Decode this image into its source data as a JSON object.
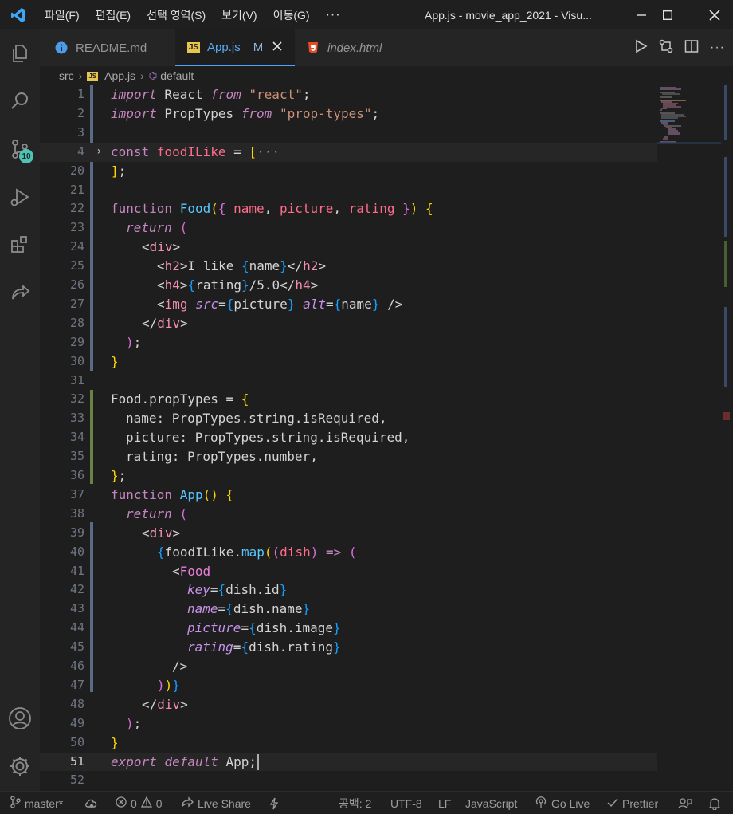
{
  "menu": [
    "파일(F)",
    "편집(E)",
    "선택 영역(S)",
    "보기(V)",
    "이동(G)"
  ],
  "window_title": "App.js - movie_app_2021 - Visu...",
  "activity": {
    "scm_badge": "10"
  },
  "tabs": [
    {
      "label": "README.md",
      "icon": "info-icon"
    },
    {
      "label": "App.js",
      "icon": "js-file-icon",
      "modified": "M",
      "active": true
    },
    {
      "label": "index.html",
      "icon": "html5-icon"
    }
  ],
  "breadcrumb": {
    "folder": "src",
    "file": "App.js",
    "symbol": "default",
    "file_icon_text": "JS"
  },
  "code_lines": [
    {
      "n": "1"
    },
    {
      "n": "2"
    },
    {
      "n": "3"
    },
    {
      "n": "4"
    },
    {
      "n": "20"
    },
    {
      "n": "21"
    },
    {
      "n": "22"
    },
    {
      "n": "23"
    },
    {
      "n": "24"
    },
    {
      "n": "25"
    },
    {
      "n": "26"
    },
    {
      "n": "27"
    },
    {
      "n": "28"
    },
    {
      "n": "29"
    },
    {
      "n": "30"
    },
    {
      "n": "31"
    },
    {
      "n": "32"
    },
    {
      "n": "33"
    },
    {
      "n": "34"
    },
    {
      "n": "35"
    },
    {
      "n": "36"
    },
    {
      "n": "37"
    },
    {
      "n": "38"
    },
    {
      "n": "39"
    },
    {
      "n": "40"
    },
    {
      "n": "41"
    },
    {
      "n": "42"
    },
    {
      "n": "43"
    },
    {
      "n": "44"
    },
    {
      "n": "45"
    },
    {
      "n": "46"
    },
    {
      "n": "47"
    },
    {
      "n": "48"
    },
    {
      "n": "49"
    },
    {
      "n": "50"
    },
    {
      "n": "51"
    },
    {
      "n": "52"
    }
  ],
  "code": {
    "l1": [
      "import",
      " React ",
      "from",
      " ",
      "\"react\"",
      ";"
    ],
    "l2": [
      "import",
      " PropTypes ",
      "from",
      " ",
      "\"prop-types\"",
      ";"
    ],
    "l4": [
      "const",
      " ",
      "foodILike",
      " = ",
      "[",
      "···"
    ],
    "l20": [
      "]",
      ";"
    ],
    "l22": [
      "function",
      " ",
      "Food",
      "(",
      "{",
      " ",
      "name",
      ", ",
      "picture",
      ", ",
      "rating",
      " ",
      "}",
      ")",
      " ",
      "{"
    ],
    "l23": [
      "return",
      " ",
      "("
    ],
    "l24": [
      "<",
      "div",
      ">"
    ],
    "l25": [
      "<",
      "h2",
      ">",
      "I like ",
      "{",
      "name",
      "}",
      "</",
      "h2",
      ">"
    ],
    "l26": [
      "<",
      "h4",
      ">",
      "{",
      "rating",
      "}",
      "/5.0",
      "</",
      "h4",
      ">"
    ],
    "l27": [
      "<",
      "img",
      " ",
      "src",
      "=",
      "{",
      "picture",
      "}",
      " ",
      "alt",
      "=",
      "{",
      "name",
      "}",
      " />"
    ],
    "l28": [
      "</",
      "div",
      ">"
    ],
    "l29": [
      ")",
      ";"
    ],
    "l30": [
      "}"
    ],
    "l32": [
      "Food.propTypes",
      " = ",
      "{"
    ],
    "l33": [
      "name: PropTypes.string.isRequired,"
    ],
    "l34": [
      "picture: PropTypes.string.isRequired,"
    ],
    "l35": [
      "rating: PropTypes.number,"
    ],
    "l36": [
      "}",
      ";"
    ],
    "l37": [
      "function",
      " ",
      "App",
      "(",
      ")",
      " ",
      "{"
    ],
    "l38": [
      "return",
      " ",
      "("
    ],
    "l39": [
      "<",
      "div",
      ">"
    ],
    "l40": [
      "{",
      "foodILike",
      ".",
      "map",
      "(",
      "(",
      "dish",
      ")",
      " => ",
      "("
    ],
    "l41": [
      "<",
      "Food"
    ],
    "l42": [
      "key",
      "=",
      "{",
      "dish.id",
      "}"
    ],
    "l43": [
      "name",
      "=",
      "{",
      "dish.name",
      "}"
    ],
    "l44": [
      "picture",
      "=",
      "{",
      "dish.image",
      "}"
    ],
    "l45": [
      "rating",
      "=",
      "{",
      "dish.rating",
      "}"
    ],
    "l46": [
      "/>"
    ],
    "l47": [
      ")",
      ")",
      "}"
    ],
    "l48": [
      "</",
      "div",
      ">"
    ],
    "l49": [
      ")",
      ";"
    ],
    "l50": [
      "}"
    ],
    "l51": [
      "export",
      " ",
      "default",
      " App;"
    ]
  },
  "status": {
    "branch": "master*",
    "errors": "0",
    "warnings": "0",
    "live_share": "Live Share",
    "spaces": "공백: 2",
    "encoding": "UTF-8",
    "eol": "LF",
    "language": "JavaScript",
    "go_live": "Go Live",
    "prettier": "Prettier"
  },
  "colors": {
    "accent": "#4fa3ff",
    "badge": "#4fc1b5",
    "js_icon": "#e8c64b",
    "html_icon": "#e44d26"
  }
}
